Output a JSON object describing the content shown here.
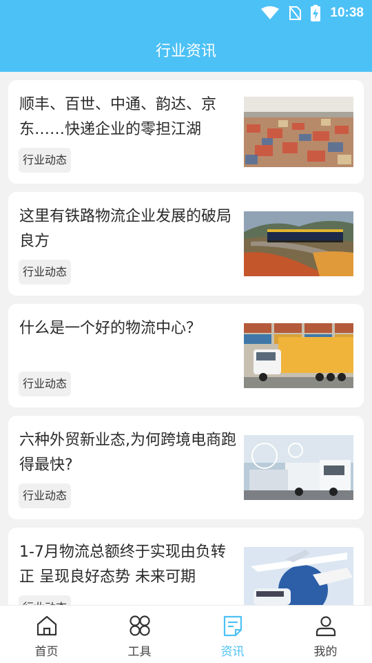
{
  "status": {
    "time": "10:38"
  },
  "header": {
    "title": "行业资讯"
  },
  "articles": [
    {
      "title": "顺丰、百世、中通、韵达、京东……快递企业的零担江湖",
      "tag": "行业动态"
    },
    {
      "title": "这里有铁路物流企业发展的破局良方",
      "tag": "行业动态"
    },
    {
      "title": "什么是一个好的物流中心？",
      "tag": "行业动态"
    },
    {
      "title": "六种外贸新业态,为何跨境电商跑得最快?",
      "tag": "行业动态"
    },
    {
      "title": "1-7月物流总额终于实现由负转正 呈现良好态势 未来可期",
      "tag": "行业动态"
    }
  ],
  "nav": {
    "items": [
      {
        "label": "首页",
        "icon": "home-icon"
      },
      {
        "label": "工具",
        "icon": "grid-icon"
      },
      {
        "label": "资讯",
        "icon": "news-icon"
      },
      {
        "label": "我的",
        "icon": "user-icon"
      }
    ],
    "active_index": 2,
    "active_color": "#4cc1f6"
  },
  "colors": {
    "header": "#4cc1f6",
    "background": "#f2f2f2"
  }
}
